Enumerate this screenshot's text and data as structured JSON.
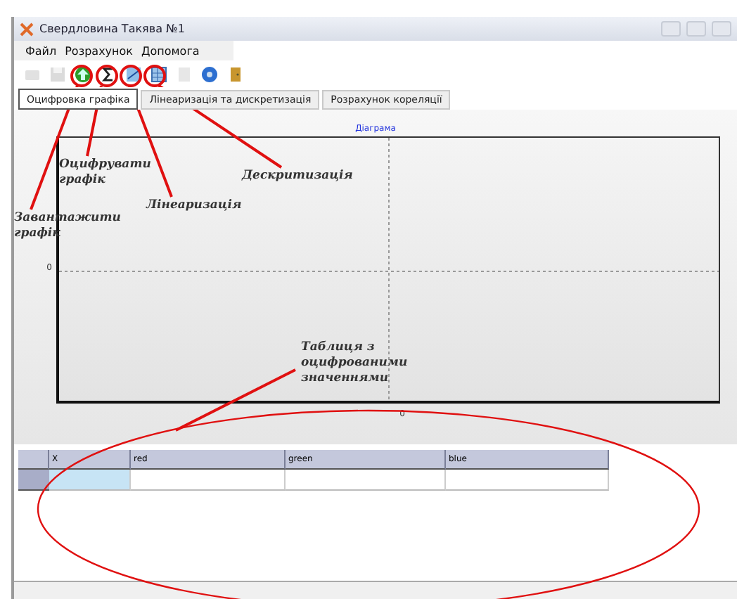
{
  "window": {
    "title": "Свердловина Такява №1"
  },
  "menu": [
    "Файл",
    "Розрахунок",
    "Допомога"
  ],
  "toolbar": [
    {
      "kind": "open",
      "disabled": true
    },
    {
      "kind": "save",
      "disabled": true
    },
    {
      "kind": "load",
      "disabled": false
    },
    {
      "kind": "sigma",
      "disabled": false
    },
    {
      "kind": "linear",
      "disabled": false
    },
    {
      "kind": "grid",
      "disabled": false
    },
    {
      "kind": "export",
      "disabled": true
    },
    {
      "kind": "help",
      "disabled": false
    },
    {
      "kind": "exit",
      "disabled": false
    }
  ],
  "tabs": [
    {
      "label": "Оцифровка графіка",
      "selected": true
    },
    {
      "label": "Лінеаризація та дискретизація",
      "selected": false
    },
    {
      "label": "Розрахунок кореляції",
      "selected": false
    }
  ],
  "chart": {
    "title": "Діаграма",
    "y_tick": "0",
    "x_tick": "0"
  },
  "table": {
    "columns": [
      "X",
      "red",
      "green",
      "blue"
    ],
    "rows": [
      {
        "selected": true
      }
    ]
  },
  "annotations": [
    "Оцифрувати графік",
    "Дескритизація",
    "Лінеаризація",
    "Завантажити графік",
    "Таблиця з оцифрованими значеннями"
  ]
}
